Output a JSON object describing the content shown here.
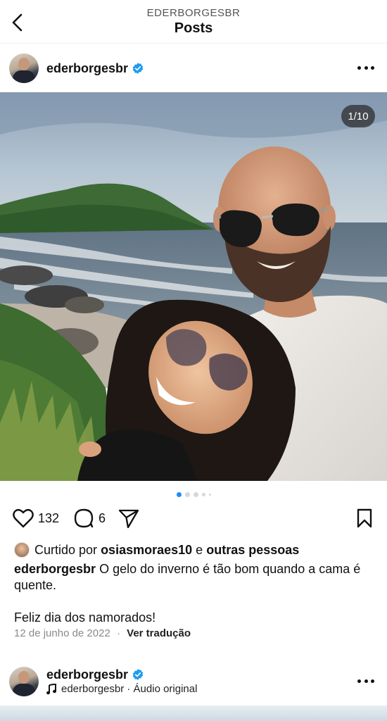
{
  "header": {
    "subtitle": "EDERBORGESBR",
    "title": "Posts"
  },
  "post": {
    "username": "ederborgesbr",
    "verified": true,
    "photo_counter": "1/10",
    "photo_description_icon": "beach-selfie-photo",
    "carousel": {
      "total_dots_visible": 5,
      "active_index": 0
    },
    "likes_count": "132",
    "comments_count": "6",
    "liked_by_prefix": "Curtido por",
    "liked_by_user": "osiasmoraes10",
    "liked_by_join": "e",
    "liked_by_others": "outras pessoas",
    "caption_username": "ederborgesbr",
    "caption_text": "O gelo do inverno é tão bom quando a cama é quente.",
    "caption_line2": "Feliz dia dos namorados!",
    "date": "12 de junho de 2022",
    "separator": "·",
    "translate_label": "Ver tradução"
  },
  "next_post": {
    "username": "ederborgesbr",
    "verified": true,
    "audio_text": "ederborgesbr · Áudio original"
  },
  "icons": {
    "back": "chevron-left-icon",
    "verified": "verified-badge-icon",
    "more": "more-horizontal-icon",
    "like": "heart-icon",
    "comment": "comment-bubble-icon",
    "share": "paper-plane-icon",
    "save": "bookmark-icon",
    "audio": "music-note-icon"
  },
  "colors": {
    "verified_blue": "#1d9bf0",
    "active_dot": "#1a8cff",
    "text": "#111111",
    "meta_gray": "#8a8a8a"
  }
}
